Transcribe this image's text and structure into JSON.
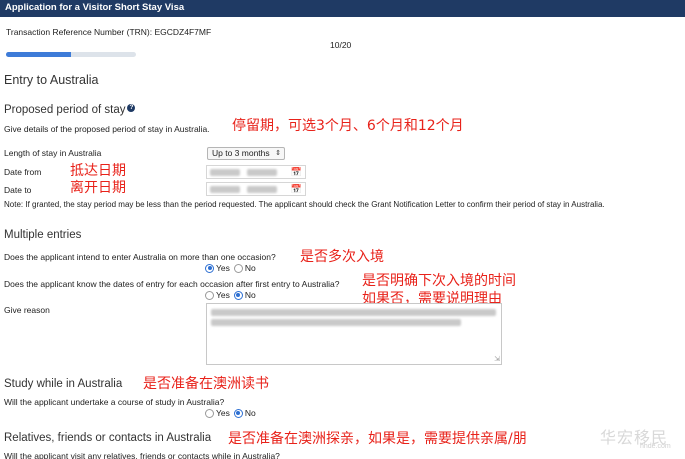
{
  "window": {
    "title": "Application for a Visitor Short Stay Visa"
  },
  "header": {
    "trn_label": "Transaction Reference Number (TRN): EGCDZ4F7MF",
    "page_counter": "10/20",
    "progress_fraction": 0.5
  },
  "section": {
    "title": "Entry to Australia"
  },
  "stay": {
    "title": "Proposed period of stay",
    "help_icon": "?",
    "description": "Give details of the proposed period of stay in Australia.",
    "annotation": "停留期，可选3个月、6个月和12个月",
    "length_label": "Length of stay in Australia",
    "length_value": "Up to 3 months",
    "date_from_label": "Date from",
    "date_from_annotation": "抵达日期",
    "date_to_label": "Date to",
    "date_to_annotation": "离开日期",
    "note": "Note: If granted, the stay period may be less than the period requested. The applicant should check the Grant Notification Letter to confirm their period of stay in Australia."
  },
  "multiple": {
    "title": "Multiple entries",
    "q1": "Does the applicant intend to enter Australia on more than one occasion?",
    "q1_annotation": "是否多次入境",
    "q2": "Does the applicant know the dates of entry for each occasion after first entry to Australia?",
    "q2_annotation_1": "是否明确下次入境的时间",
    "q2_annotation_2": "如果否，需要说明理由",
    "reason_label": "Give reason",
    "yes": "Yes",
    "no": "No"
  },
  "study": {
    "title": "Study while in Australia",
    "annotation": "是否准备在澳洲读书",
    "q": "Will the applicant undertake a course of study in Australia?"
  },
  "relatives": {
    "title": "Relatives, friends or contacts in Australia",
    "annotation": "是否准备在澳洲探亲，如果是，需要提供亲属/朋",
    "q": "Will the applicant visit any relatives, friends or contacts while in Australia?"
  },
  "watermark": {
    "text": "华宏移民",
    "sub": "hhde.com"
  },
  "icons": {
    "calendar": "calendar-icon",
    "help": "help-icon",
    "dropdown": "chevron-updown-icon"
  }
}
